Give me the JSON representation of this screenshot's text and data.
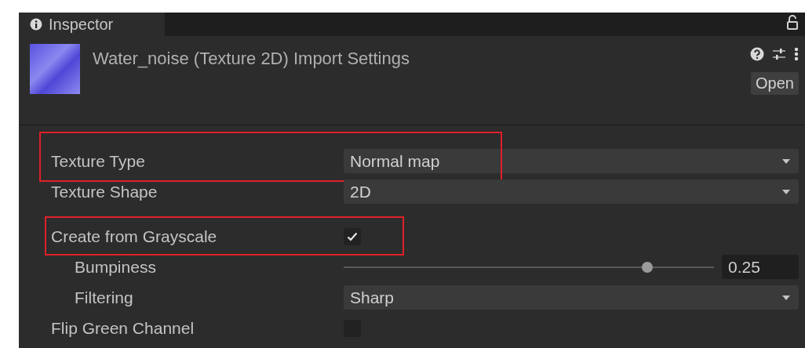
{
  "tab": {
    "label": "Inspector",
    "selected": true
  },
  "header": {
    "title": "Water_noise (Texture 2D) Import Settings",
    "open_button": "Open"
  },
  "sections": [
    {
      "rows": [
        {
          "kind": "dropdown",
          "label": "Texture Type",
          "value": "Normal map",
          "highlighted": true
        },
        {
          "kind": "dropdown",
          "label": "Texture Shape",
          "value": "2D",
          "highlighted": false
        }
      ]
    },
    {
      "rows": [
        {
          "kind": "checkbox",
          "label": "Create from Grayscale",
          "checked": true,
          "highlighted": true,
          "children": [
            {
              "kind": "slider",
              "label": "Bumpiness",
              "level": 0.82,
              "value": "0.25",
              "highlighted": false
            },
            {
              "kind": "dropdown",
              "label": "Filtering",
              "value": "Sharp",
              "highlighted": false
            }
          ]
        },
        {
          "kind": "checkbox",
          "label": "Flip Green Channel",
          "checked": false,
          "highlighted": false
        }
      ]
    }
  ]
}
